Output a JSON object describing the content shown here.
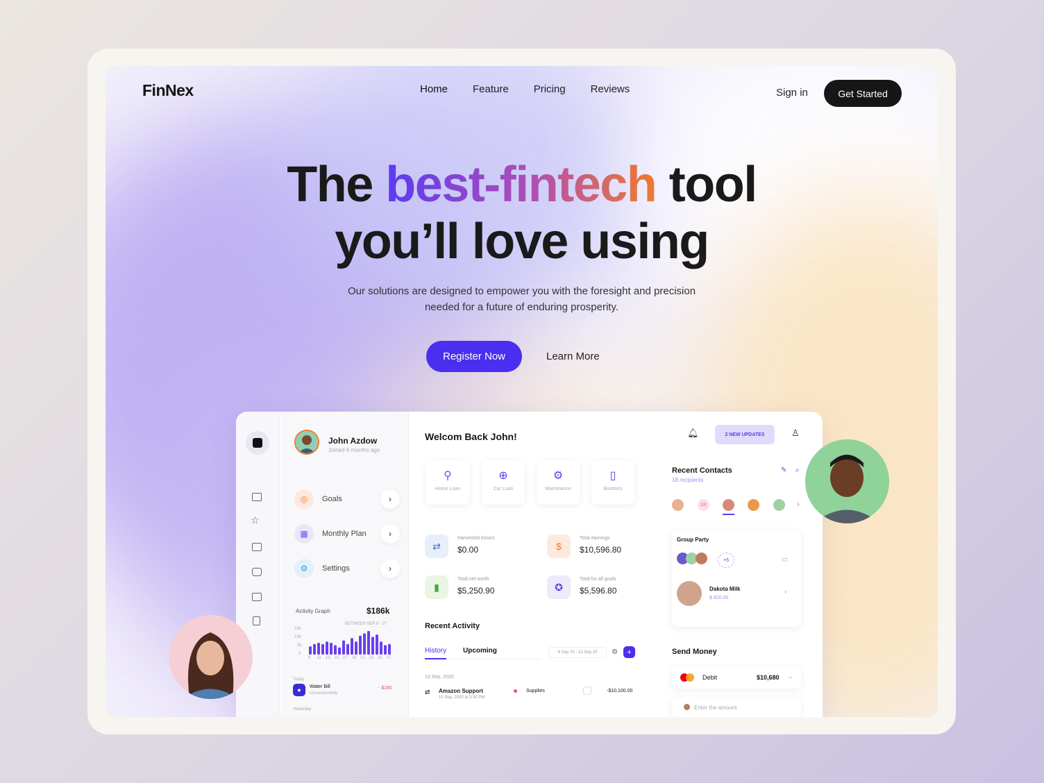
{
  "brand": {
    "name": "FinNex"
  },
  "nav": {
    "items": [
      "Home",
      "Feature",
      "Pricing",
      "Reviews"
    ],
    "signin": "Sign in",
    "cta": "Get Started"
  },
  "hero": {
    "line1_a": "The ",
    "line1_grad": "best-fintech",
    "line1_b": " tool",
    "line2": "you’ll love using",
    "sub1": "Our solutions are designed to empower you with the foresight and precision",
    "sub2": "needed for a future of enduring prosperity.",
    "primary": "Register Now",
    "secondary": "Learn More"
  },
  "dashboard": {
    "user": {
      "name": "John Azdow",
      "joined": "Joined 6 months ago"
    },
    "menu": [
      {
        "label": "Goals",
        "icon": "target-icon"
      },
      {
        "label": "Monthly Plan",
        "icon": "calendar-icon"
      },
      {
        "label": "Settings",
        "icon": "gear-icon"
      }
    ],
    "activity": {
      "title": "Activity Graph",
      "value": "$186k",
      "range": "BETWEEN SEP 9 - 27",
      "bars": [
        0.35,
        0.45,
        0.5,
        0.45,
        0.55,
        0.5,
        0.4,
        0.3,
        0.6,
        0.45,
        0.7,
        0.55,
        0.8,
        0.9,
        1.0,
        0.75,
        0.85,
        0.55,
        0.4,
        0.45
      ],
      "yticks": [
        "15k",
        "10k",
        "5k",
        "0"
      ],
      "xticks": [
        "9",
        "11",
        "13",
        "15",
        "17",
        "19",
        "21",
        "23",
        "25",
        "27"
      ],
      "today": "Today",
      "bill": "Water Bill",
      "bill_status": "Unsuccessfully",
      "bill_amount": "- $280",
      "yesterday": "Yesterday"
    },
    "welcome": "Welcom Back John!",
    "services": [
      "Home Loan",
      "Car Loan",
      "Maintinance",
      "Boosters"
    ],
    "stats": [
      {
        "title": "Harvested losses",
        "value": "$0.00"
      },
      {
        "title": "Total earnings",
        "value": "$10,596.80"
      },
      {
        "title": "Total net worth",
        "value": "$5,250.90"
      },
      {
        "title": "Total for all goals",
        "value": "$5,596.80"
      }
    ],
    "recent": {
      "title": "Recent Activity",
      "tab_history": "History",
      "tab_upcoming": "Upcoming",
      "range": "6 Sep 20 - 13 Sep 20",
      "date": "13 Sep, 2020",
      "row_name": "Amazon Support",
      "row_time": "10 Sep, 2020 at 3:30 PM",
      "row_cat": "Supplies",
      "row_amount": "-$10,100.00"
    },
    "updates": "2 NEW UPDATES",
    "contacts": {
      "title": "Recent Contacts",
      "count": "18 recipients",
      "initials": "DS"
    },
    "group": {
      "title": "Group Party",
      "more": "+5",
      "member": "Dakota Milk",
      "member_amount": "$ 420.00"
    },
    "send": {
      "title": "Send Money",
      "card": "Debit",
      "balance": "$10,680",
      "placeholder": "Enter the amount"
    }
  }
}
